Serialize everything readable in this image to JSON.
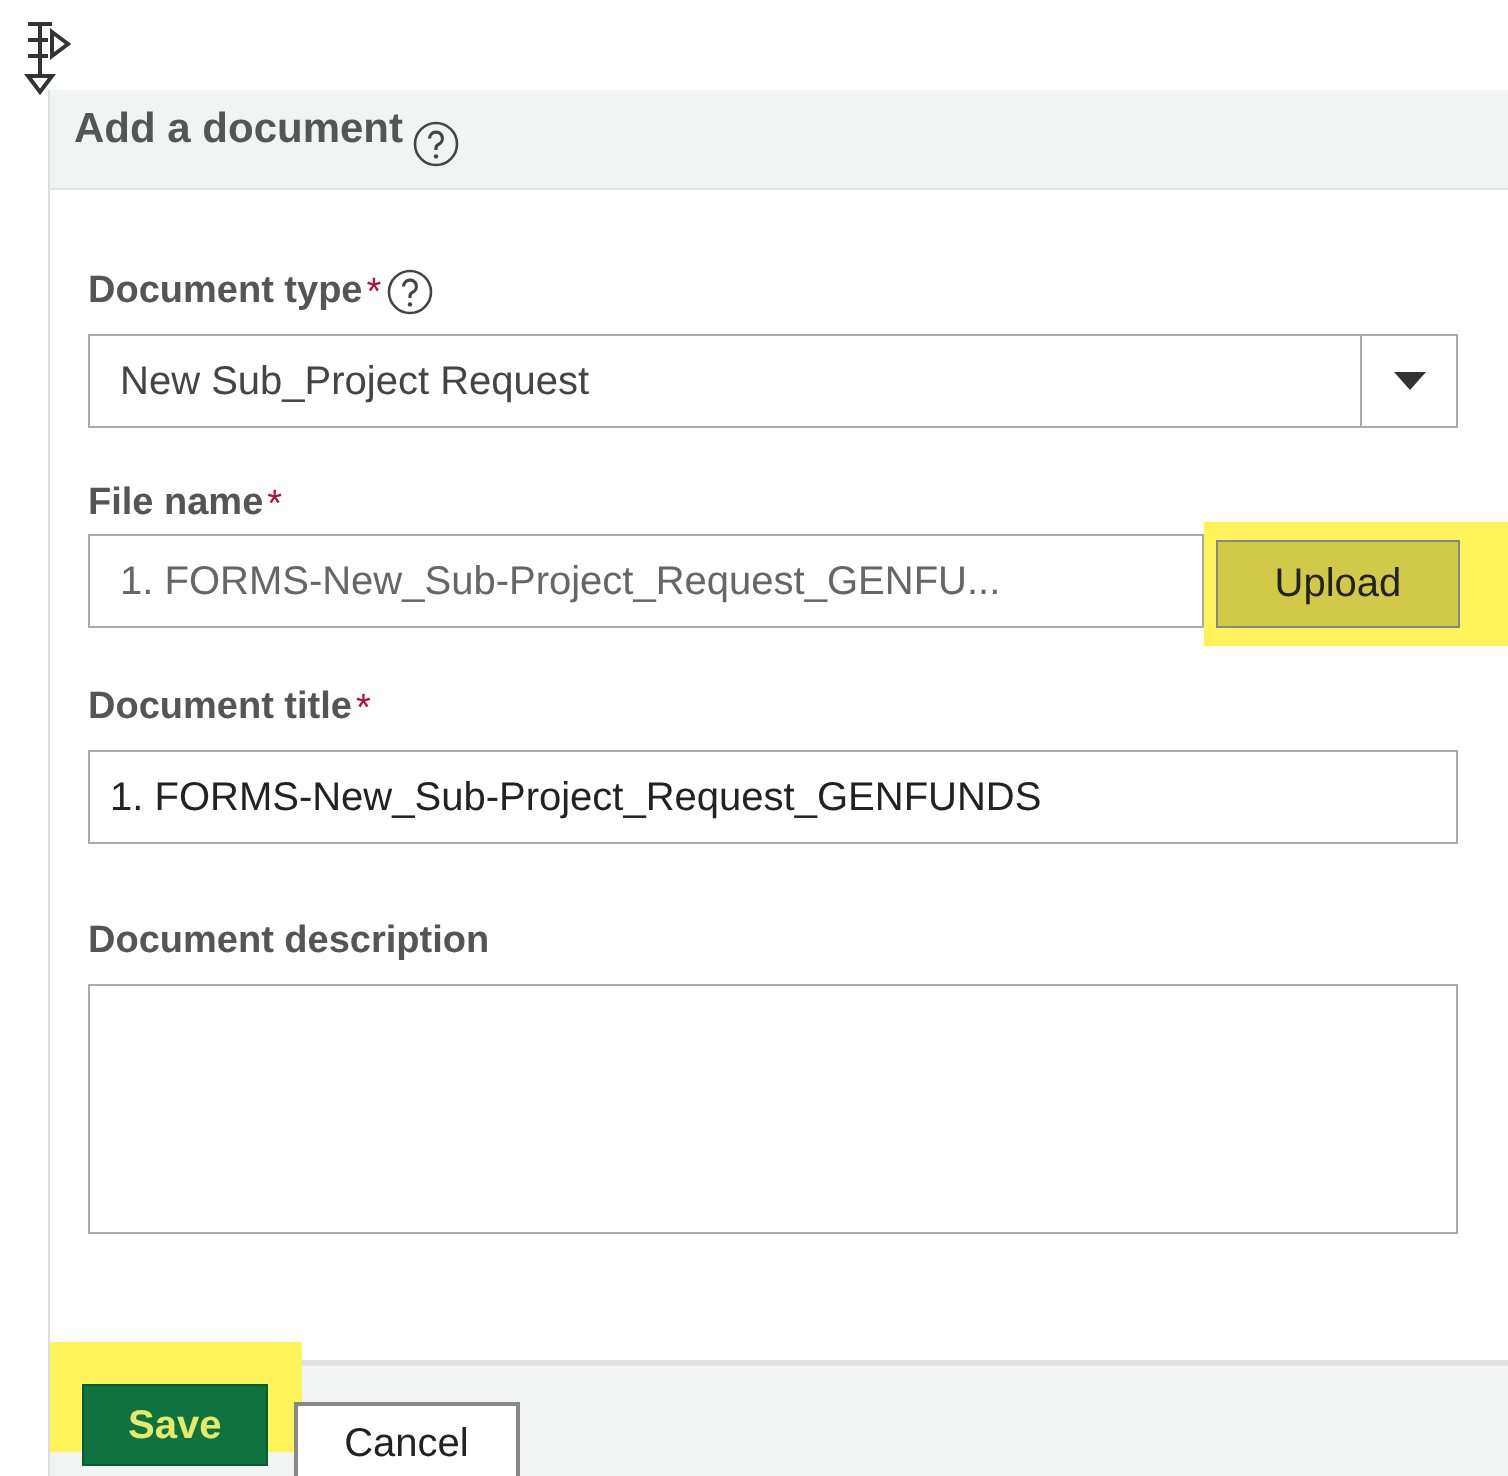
{
  "dialog": {
    "title": "Add a document",
    "help": true
  },
  "fields": [
    {
      "kind": "select",
      "label": "Document type",
      "required": true,
      "help": true,
      "value": "New Sub_Project Request"
    },
    {
      "kind": "file",
      "label": "File name",
      "required": true,
      "help": false,
      "value": "1. FORMS-New_Sub-Project_Request_GENFU...",
      "button": "Upload",
      "highlighted": true
    },
    {
      "kind": "text",
      "label": "Document title",
      "required": true,
      "help": false,
      "value": "1. FORMS-New_Sub-Project_Request_GENFUNDS"
    },
    {
      "kind": "textarea",
      "label": "Document description",
      "required": false,
      "help": false
    }
  ],
  "buttons": [
    {
      "label": "Save",
      "kind": "primary",
      "highlighted": true
    },
    {
      "label": "Cancel",
      "kind": "secondary",
      "highlighted": false
    }
  ],
  "required_mark": "*"
}
